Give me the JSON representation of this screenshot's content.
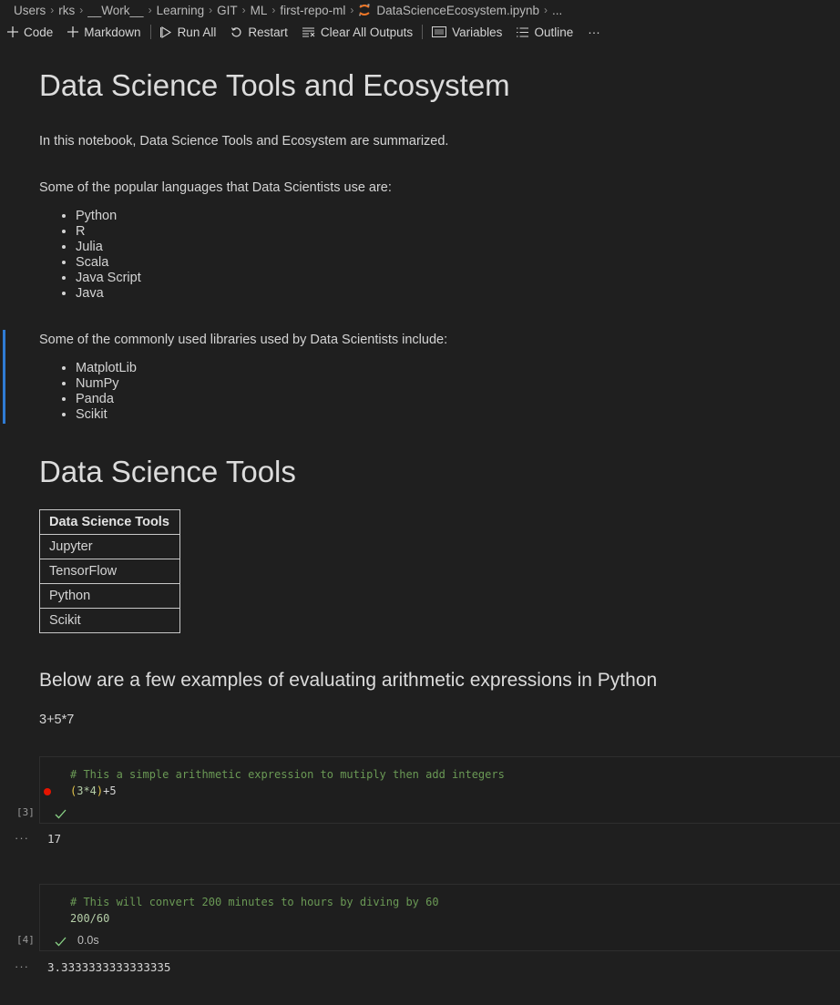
{
  "breadcrumb": {
    "items": [
      "Users",
      "rks",
      "__Work__",
      "Learning",
      "GIT",
      "ML",
      "first-repo-ml"
    ],
    "file": "DataScienceEcosystem.ipynb",
    "more": "..."
  },
  "toolbar": {
    "code": "Code",
    "markdown": "Markdown",
    "run_all": "Run All",
    "restart": "Restart",
    "clear_all_outputs": "Clear All Outputs",
    "variables": "Variables",
    "outline": "Outline",
    "more": "···"
  },
  "notebook": {
    "title": "Data Science Tools and Ecosystem",
    "intro": "In this notebook, Data Science Tools and Ecosystem are summarized.",
    "languages_intro": "Some of the popular languages that Data Scientists use are:",
    "languages": [
      "Python",
      "R",
      "Julia",
      "Scala",
      "Java Script",
      "Java"
    ],
    "libraries_intro": "Some of the commonly used libraries used by Data Scientists include:",
    "libraries": [
      "MatplotLib",
      "NumPy",
      "Panda",
      "Scikit"
    ],
    "tools_heading": "Data Science Tools",
    "tools_table": {
      "header": "Data Science Tools",
      "rows": [
        "Jupyter",
        "TensorFlow",
        "Python",
        "Scikit"
      ]
    },
    "arith_heading": "Below are a few examples of evaluating arithmetic expressions in Python",
    "arith_example": "3+5*7",
    "cells": [
      {
        "comment": "# This a simple arithmetic expression to mutiply then add integers",
        "code_open": "(",
        "code_mid": "3*4",
        "code_close": ")",
        "code_tail": "+5",
        "exec_count": "[3]",
        "duration": "",
        "output": "17",
        "output_dots": "···"
      },
      {
        "comment": "# This will convert 200 minutes to hours by diving by 60",
        "code": "200/60",
        "exec_count": "[4]",
        "duration": "0.0s",
        "output": "3.3333333333333335",
        "output_dots": "···"
      }
    ]
  },
  "colors": {
    "background": "#1f1f1f",
    "active_cell_bar": "#2f7bd3",
    "comment": "#6a9955",
    "breakpoint": "#e51400",
    "success_check": "#89d185"
  }
}
